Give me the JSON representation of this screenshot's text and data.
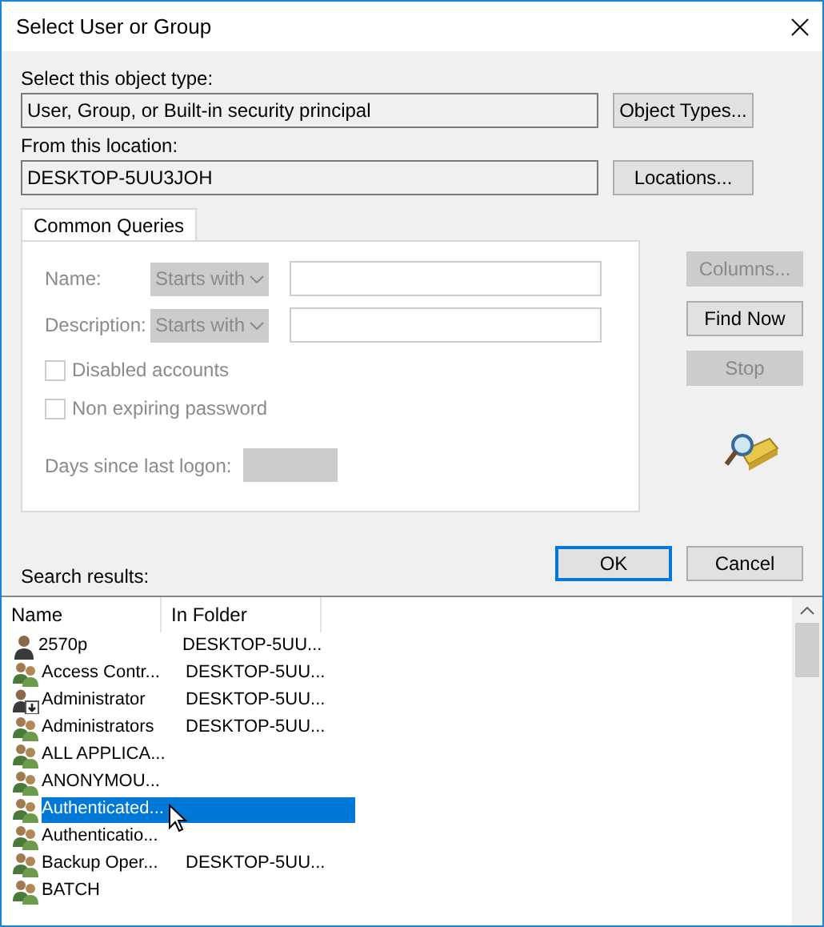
{
  "window": {
    "title": "Select User or Group"
  },
  "object_type": {
    "label": "Select this object type:",
    "value": "User, Group, or Built-in security principal",
    "button": "Object Types..."
  },
  "location": {
    "label": "From this location:",
    "value": "DESKTOP-5UU3JOH",
    "button": "Locations..."
  },
  "tabs": [
    {
      "label": "Common Queries",
      "selected": true
    }
  ],
  "query": {
    "fields": [
      {
        "label": "Name:",
        "match": "Starts with"
      },
      {
        "label": "Description:",
        "match": "Starts with"
      }
    ],
    "checkboxes": [
      {
        "label": "Disabled accounts",
        "checked": false
      },
      {
        "label": "Non expiring password",
        "checked": false
      }
    ],
    "days_label": "Days since last logon:",
    "disabled": true
  },
  "side_buttons": [
    {
      "label": "Columns...",
      "disabled": true
    },
    {
      "label": "Find Now",
      "disabled": false
    },
    {
      "label": "Stop",
      "disabled": true
    }
  ],
  "dialog_buttons": [
    {
      "label": "OK",
      "default": true
    },
    {
      "label": "Cancel",
      "default": false
    }
  ],
  "results": {
    "label": "Search results:",
    "columns": [
      "Name",
      "In Folder"
    ],
    "rows": [
      {
        "kind": "user",
        "name": "2570p",
        "folder": "DESKTOP-5UU...",
        "selected": false
      },
      {
        "kind": "group",
        "name": "Access Contr...",
        "folder": "DESKTOP-5UU...",
        "selected": false
      },
      {
        "kind": "admin",
        "name": "Administrator",
        "folder": "DESKTOP-5UU...",
        "selected": false
      },
      {
        "kind": "group",
        "name": "Administrators",
        "folder": "DESKTOP-5UU...",
        "selected": false
      },
      {
        "kind": "group",
        "name": "ALL APPLICA...",
        "selected": false
      },
      {
        "kind": "group",
        "name": "ANONYMOU...",
        "selected": false
      },
      {
        "kind": "group",
        "name": "Authenticated...",
        "selected": true
      },
      {
        "kind": "group",
        "name": "Authenticatio...",
        "selected": false
      },
      {
        "kind": "group",
        "name": "Backup Oper...",
        "folder": "DESKTOP-5UU...",
        "selected": false
      },
      {
        "kind": "group",
        "name": "BATCH",
        "selected": false
      }
    ]
  }
}
